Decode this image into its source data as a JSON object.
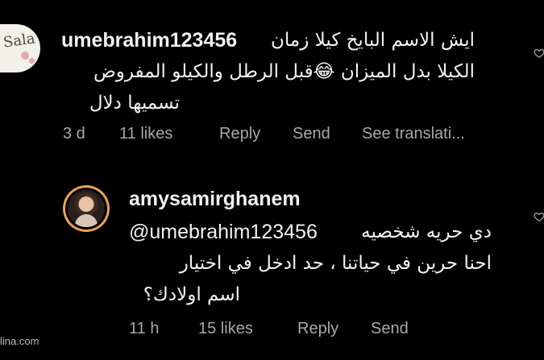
{
  "comments": [
    {
      "username": "umebrahim123456",
      "text_lines": [
        "ايش  الاسم البايخ كيلا زمان",
        "الكيلا بدل الميزان 😂قبل الرطل والكيلو المفروض",
        "تسميها دلال"
      ],
      "time": "3 d",
      "likes": "11 likes",
      "reply": "Reply",
      "send": "Send",
      "see_translation": "See translati..."
    },
    {
      "username": "amysamirghanem",
      "mention": "@umebrahim123456",
      "text_lines": [
        "دي حريه شخصيه",
        "احنا حرين في حياتنا ، حد ادخل في اختيار",
        "اسم اولادك؟"
      ],
      "time": "11 h",
      "likes": "15 likes",
      "reply": "Reply",
      "send": "Send"
    }
  ],
  "watermark": "lina.com",
  "avatar_1_script": "Sala",
  "colors": {
    "background": "#000000",
    "text": "#f2f2f2",
    "meta": "#a8a8a8",
    "story_ring": "#e9a15a"
  },
  "icons": {
    "like": "heart-outline-icon"
  }
}
